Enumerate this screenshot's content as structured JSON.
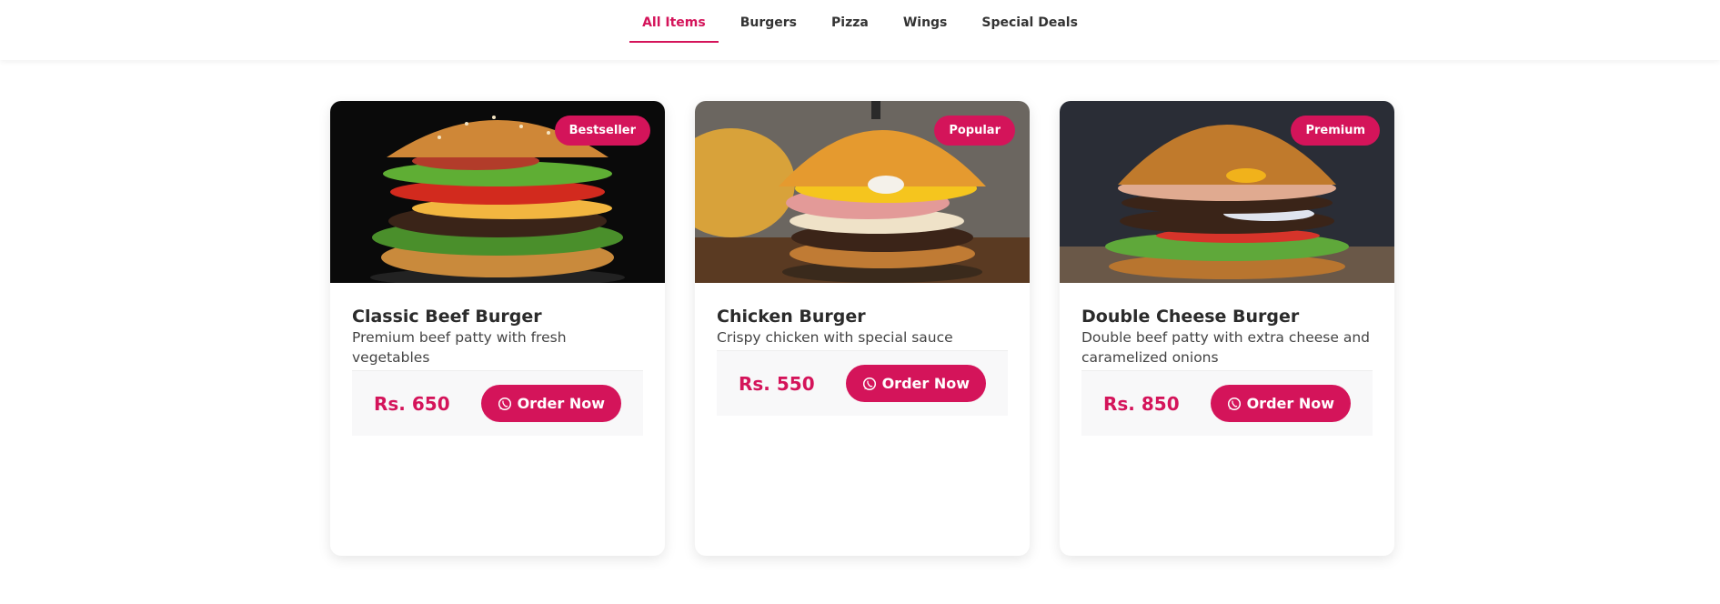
{
  "nav": {
    "tabs": [
      {
        "label": "All Items",
        "active": true
      },
      {
        "label": "Burgers",
        "active": false
      },
      {
        "label": "Pizza",
        "active": false
      },
      {
        "label": "Wings",
        "active": false
      },
      {
        "label": "Special Deals",
        "active": false
      }
    ]
  },
  "colors": {
    "accent": "#d4145a",
    "text": "#2b2b2b",
    "card_footer_bg": "#f8f8f9"
  },
  "order_icon": "whatsapp-icon",
  "products": [
    {
      "name": "Classic Beef Burger",
      "description": "Premium beef patty with fresh vegetables",
      "badge": "Bestseller",
      "price": "Rs. 650",
      "button_label": "Order Now"
    },
    {
      "name": "Chicken Burger",
      "description": "Crispy chicken with special sauce",
      "badge": "Popular",
      "price": "Rs. 550",
      "button_label": "Order Now"
    },
    {
      "name": "Double Cheese Burger",
      "description": "Double beef patty with extra cheese and caramelized onions",
      "badge": "Premium",
      "price": "Rs. 850",
      "button_label": "Order Now"
    }
  ]
}
